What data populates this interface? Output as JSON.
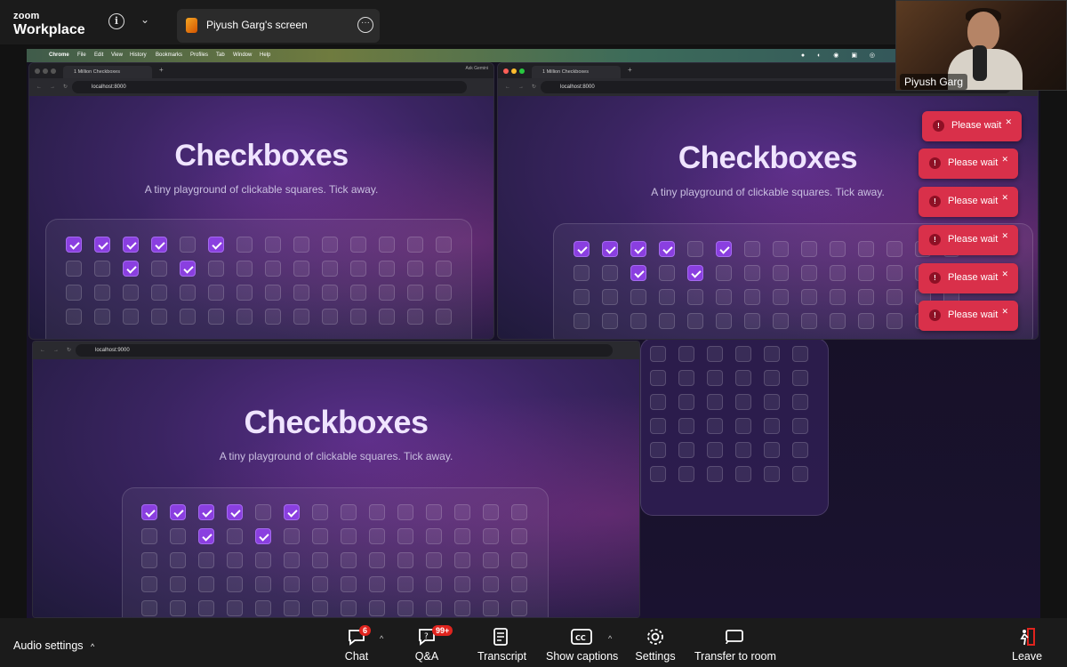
{
  "zoom": {
    "logo_line1": "zoom",
    "logo_line2": "Workplace",
    "info_glyph": "i",
    "share_label": "Piyush Garg's screen",
    "participant_name": "Piyush Garg"
  },
  "mac_menu": [
    "Chrome",
    "File",
    "Edit",
    "View",
    "History",
    "Bookmarks",
    "Profiles",
    "Tab",
    "Window",
    "Help"
  ],
  "windows": [
    {
      "tab_title": "1 Million Checkboxes",
      "url": "localhost:8000",
      "ask": "Ask Gemini"
    },
    {
      "tab_title": "1 Million Checkboxes",
      "url": "localhost:8000"
    },
    {
      "url": "localhost:9000"
    }
  ],
  "app": {
    "title": "Checkboxes",
    "subtitle": "A tiny playground of clickable squares. Tick away."
  },
  "checked_cells": [
    0,
    1,
    2,
    3,
    5,
    16,
    18
  ],
  "toasts": [
    "Please wait",
    "Please wait",
    "Please wait",
    "Please wait",
    "Please wait",
    "Please wait"
  ],
  "toolbar": {
    "audio_settings": "Audio settings",
    "chat": "Chat",
    "chat_badge": "6",
    "qa": "Q&A",
    "qa_badge": "99+",
    "transcript": "Transcript",
    "show_captions": "Show captions",
    "captions_glyph": "CC",
    "settings": "Settings",
    "transfer": "Transfer to room",
    "leave": "Leave"
  },
  "colors": {
    "checked": "#8a3fe0",
    "toast": "#d9304a",
    "leave": "#e0241e"
  }
}
